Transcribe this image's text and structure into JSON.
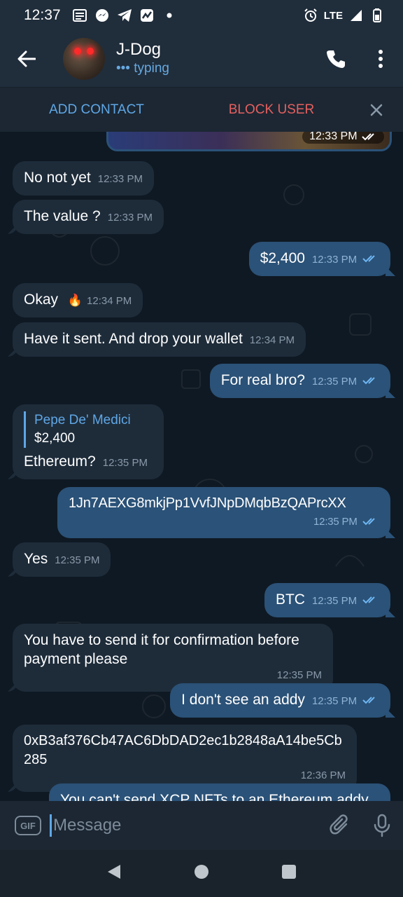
{
  "status_bar": {
    "time": "12:37",
    "network": "LTE"
  },
  "header": {
    "name": "J-Dog",
    "status": "typing",
    "typing_dots": "•••"
  },
  "action_bar": {
    "add_contact": "ADD CONTACT",
    "block_user": "BLOCK USER"
  },
  "media_message": {
    "time": "12:33 PM"
  },
  "messages": [
    {
      "dir": "in",
      "text": "No not yet",
      "time": "12:33 PM"
    },
    {
      "dir": "in",
      "text": "The value ?",
      "time": "12:33 PM"
    },
    {
      "dir": "out",
      "text": "$2,400",
      "time": "12:33 PM"
    },
    {
      "dir": "in",
      "text": "Okay",
      "emoji": "🔥",
      "time": "12:34 PM"
    },
    {
      "dir": "in",
      "text": "Have it sent. And drop your wallet",
      "time": "12:34 PM"
    },
    {
      "dir": "out",
      "text": "For real bro?",
      "time": "12:35 PM"
    },
    {
      "dir": "in",
      "reply_name": "Pepe De' Medici",
      "reply_text": "$2,400",
      "text": "Ethereum?",
      "time": "12:35 PM"
    },
    {
      "dir": "out",
      "text": "1Jn7AEXG8mkjPp1VvfJNpDMqbBzQAPrcXX",
      "time": "12:35 PM"
    },
    {
      "dir": "in",
      "text": "Yes",
      "time": "12:35 PM"
    },
    {
      "dir": "out",
      "text": "BTC",
      "time": "12:35 PM"
    },
    {
      "dir": "in",
      "text": "You have to send it for confirmation before payment please",
      "time": "12:35 PM"
    },
    {
      "dir": "out",
      "text": "I don't see an addy",
      "time": "12:35 PM"
    },
    {
      "dir": "in",
      "text": "0xB3af376Cb47AC6DbDAD2ec1b2848aA14be5Cb285",
      "time": "12:36 PM"
    },
    {
      "dir": "out",
      "text": "You can't send XCP NFTs to an Ethereum addy",
      "time": ""
    }
  ],
  "input": {
    "placeholder": "Message",
    "gif_label": "GIF"
  },
  "icons": {
    "back": "back-arrow-icon",
    "call": "phone-icon",
    "menu": "more-vertical-icon",
    "close": "close-icon",
    "attach": "paperclip-icon",
    "mic": "microphone-icon"
  },
  "colors": {
    "header_bg": "#202d3b",
    "chat_bg": "#0f1923",
    "incoming": "#1e2c3a",
    "outgoing": "#2b5278",
    "accent": "#5fa7e6",
    "danger": "#e5605f"
  }
}
